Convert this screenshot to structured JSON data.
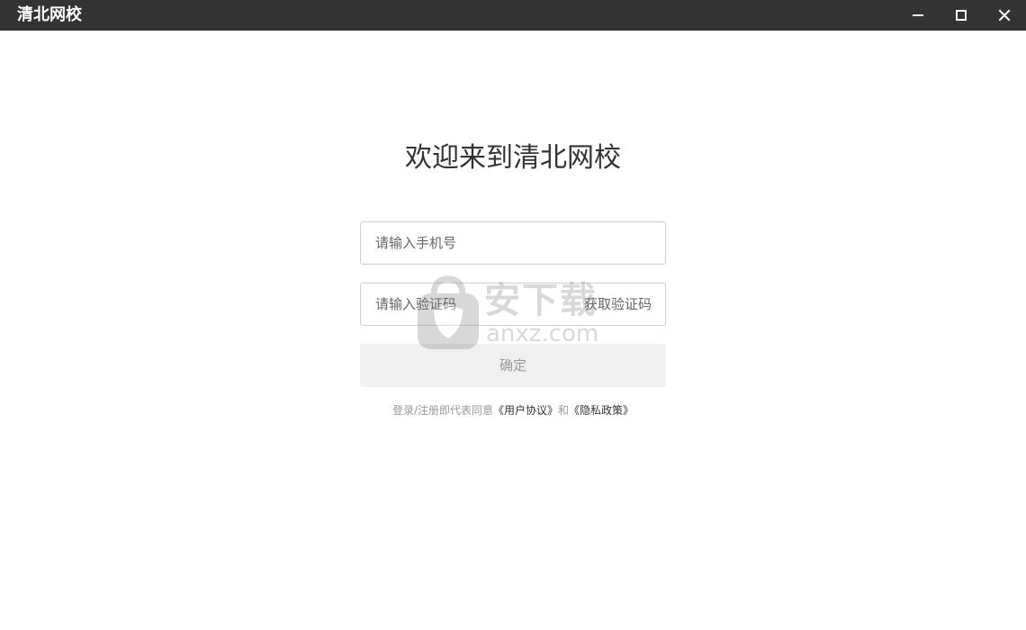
{
  "window": {
    "title": "清北网校"
  },
  "login": {
    "welcome": "欢迎来到清北网校",
    "phone_placeholder": "请输入手机号",
    "code_placeholder": "请输入验证码",
    "get_code": "获取验证码",
    "confirm": "确定",
    "agreement_prefix": "登录/注册即代表同意",
    "user_agreement": "《用户协议》",
    "agreement_and": "和",
    "privacy_policy": "《隐私政策》"
  },
  "watermark": {
    "text": "安下载",
    "domain": "anxz.com"
  },
  "colors": {
    "titlebar": "#333333",
    "button_bg": "#f0f0f0",
    "border": "#cfcfcf"
  }
}
